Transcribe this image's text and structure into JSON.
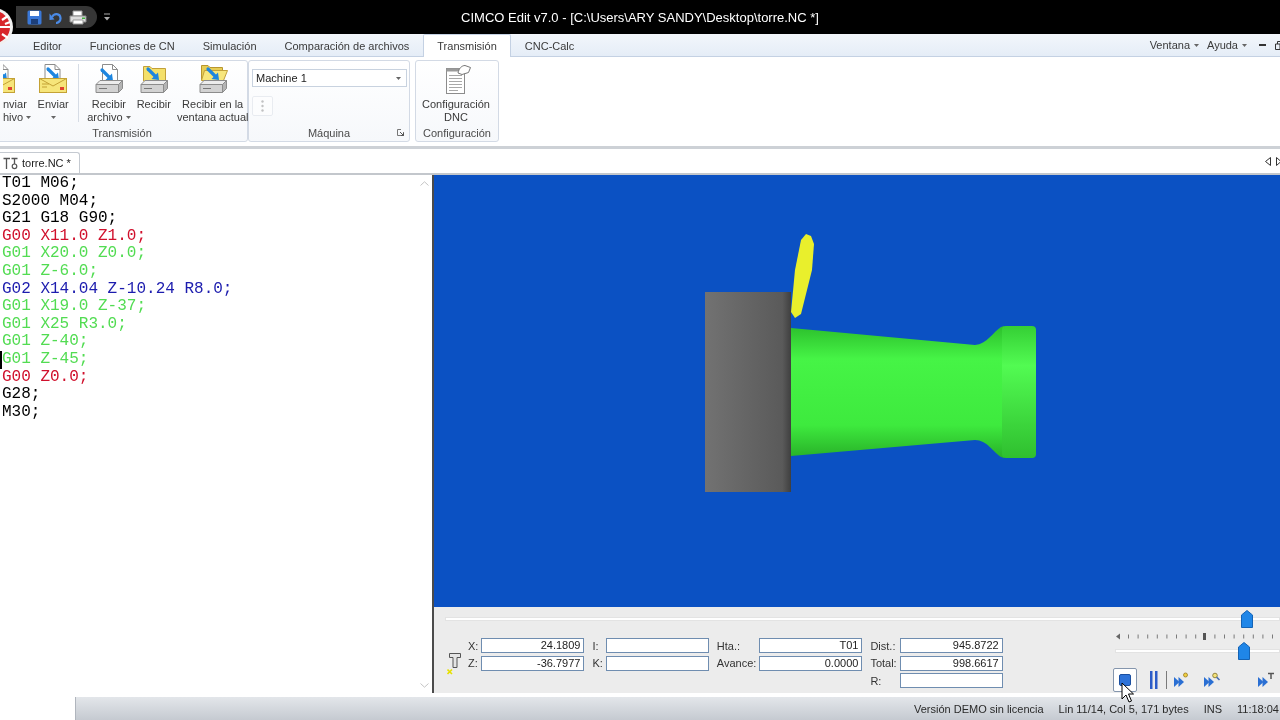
{
  "title_bar": {
    "title": "CIMCO Edit v7.0 - [C:\\Users\\ARY SANDY\\Desktop\\torre.NC *]"
  },
  "ribbon": {
    "tabs": [
      {
        "label": "Editor",
        "selected": false
      },
      {
        "label": "Funciones de CN",
        "selected": false
      },
      {
        "label": "Simulación",
        "selected": false
      },
      {
        "label": "Comparación de archivos",
        "selected": false
      },
      {
        "label": "Transmisión",
        "selected": true
      },
      {
        "label": "CNC-Calc",
        "selected": false
      }
    ],
    "menus": [
      {
        "label": "Ventana"
      },
      {
        "label": "Ayuda"
      }
    ],
    "groups": [
      {
        "kind": "buttons",
        "label": "Transmisión",
        "sections": [
          [
            {
              "kind": "send-file",
              "lines": [
                "nviar",
                "hivo"
              ],
              "dropdown": true
            },
            {
              "kind": "send",
              "lines": [
                "Enviar"
              ],
              "dropdown": true
            }
          ],
          [
            {
              "kind": "receive-file",
              "lines": [
                "Recibir",
                "archivo"
              ],
              "dropdown": true
            },
            {
              "kind": "receive",
              "lines": [
                "Recibir"
              ],
              "dropdown": false
            },
            {
              "kind": "receive-window",
              "lines": [
                "Recibir en la",
                "ventana actual"
              ],
              "dropdown": false
            }
          ]
        ]
      },
      {
        "kind": "machine",
        "label": "Máquina",
        "select": {
          "value": "Machine 1"
        },
        "tool_button": {
          "disabled": true
        }
      },
      {
        "kind": "buttons",
        "label": "Configuración",
        "sections": [
          [
            {
              "kind": "config",
              "lines": [
                "Configuración",
                "DNC"
              ],
              "dropdown": false
            }
          ]
        ]
      }
    ]
  },
  "documents": {
    "tabs": [
      {
        "label": "torre.NC *",
        "selected": true
      }
    ]
  },
  "editor": {
    "lines": [
      {
        "text": "T01 M06;",
        "color": "#000000",
        "cursor": false
      },
      {
        "text": "S2000 M04;",
        "color": "#000000",
        "cursor": false
      },
      {
        "text": "G21 G18 G90;",
        "color": "#000000",
        "cursor": false
      },
      {
        "text": "G00 X11.0 Z1.0;",
        "color": "#d0102c",
        "cursor": false
      },
      {
        "text": "G01 X20.0 Z0.0;",
        "color": "#52dc52",
        "cursor": false
      },
      {
        "text": "G01 Z-6.0;",
        "color": "#52dc52",
        "cursor": false
      },
      {
        "text": "G02 X14.04 Z-10.24 R8.0;",
        "color": "#1c1cae",
        "cursor": false
      },
      {
        "text": "G01 X19.0 Z-37;",
        "color": "#52dc52",
        "cursor": false
      },
      {
        "text": "G01 X25 R3.0;",
        "color": "#52dc52",
        "cursor": false
      },
      {
        "text": "G01 Z-40;",
        "color": "#52dc52",
        "cursor": false
      },
      {
        "text": "G01 Z-45;",
        "color": "#52dc52",
        "cursor": true
      },
      {
        "text": "G00 Z0.0;",
        "color": "#d0102c",
        "cursor": false
      },
      {
        "text": "G28;",
        "color": "#000000",
        "cursor": false
      },
      {
        "text": "M30;",
        "color": "#000000",
        "cursor": false
      }
    ]
  },
  "simulation": {
    "progress": {
      "level": 0.96
    },
    "readouts": [
      [
        {
          "label": "X:",
          "value": "24.1809"
        },
        {
          "label": "Z:",
          "value": "-36.7977"
        }
      ],
      [
        {
          "label": "I:"
        },
        {
          "label": "K:"
        }
      ],
      [
        {
          "label": "Hta.:",
          "value": "T01"
        },
        {
          "label": "Avance:",
          "value": "0.0000"
        }
      ],
      [
        {
          "label": "Dist.:",
          "value": "945.8722"
        },
        {
          "label": "Total:",
          "value": "998.6617"
        },
        {
          "label": "R:"
        }
      ]
    ],
    "speed": {
      "level": 0.78
    },
    "controls": [
      [
        {
          "kind": "stop",
          "selected": true
        },
        {
          "kind": "pause",
          "selected": false
        }
      ],
      [
        {
          "kind": "step",
          "selected": false
        },
        {
          "kind": "step-fast",
          "selected": false
        },
        {
          "kind": "step-tool",
          "selected": false
        }
      ]
    ]
  },
  "status_bar": {
    "panes": [
      "Versión DEMO sin licencia",
      "Lin 11/14, Col 5, 171 bytes",
      "INS",
      "11:18:04"
    ]
  }
}
